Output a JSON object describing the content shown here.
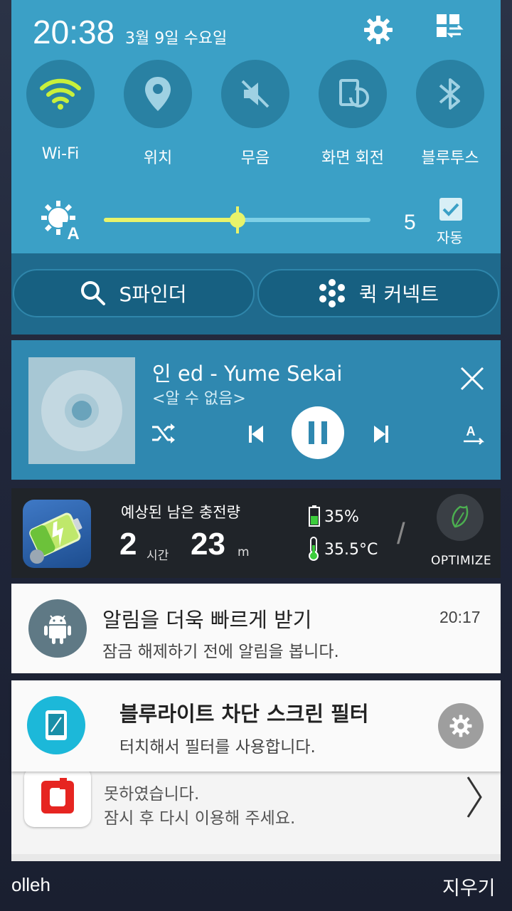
{
  "status": {
    "time": "20:38",
    "date": "3월 9일 수요일"
  },
  "quick_toggles": [
    {
      "label": "Wi-Fi",
      "icon": "wifi-icon",
      "active": true
    },
    {
      "label": "위치",
      "icon": "location-icon",
      "active": false
    },
    {
      "label": "무음",
      "icon": "mute-icon",
      "active": false
    },
    {
      "label": "화면 회전",
      "icon": "screen-rotation-icon",
      "active": false
    },
    {
      "label": "블루투스",
      "icon": "bluetooth-icon",
      "active": false
    }
  ],
  "brightness": {
    "level": 0.5,
    "value": "5",
    "auto_checked": true,
    "auto_label": "자동"
  },
  "panel_buttons": {
    "s_finder": "S파인더",
    "quick_connect": "퀵 커넥트"
  },
  "music": {
    "title": "인 ed - Yume Sekai",
    "artist": "<알 수 없음>"
  },
  "battery_widget": {
    "title": "예상된 남은 충전량",
    "hours": "2",
    "hours_unit": "시간",
    "minutes": "23",
    "minutes_unit": "m",
    "percent": "35%",
    "temperature": "35.5°C",
    "optimize_label": "OPTIMIZE"
  },
  "notifications": [
    {
      "title": "알림을 더욱 빠르게 받기",
      "text": "잠금 해제하기 전에 알림을 봅니다.",
      "time": "20:17",
      "icon": "android-icon"
    },
    {
      "title": "블루라이트 차단 스크린 필터",
      "text": "터치해서 필터를 사용합니다.",
      "icon": "phone-screen-icon"
    },
    {
      "text_line1": "못하였습니다.",
      "text_line2": "잠시 후 다시 이용해 주세요.",
      "icon": "app-logo-icon"
    }
  ],
  "footer": {
    "carrier": "olleh",
    "clear_all": "지우기"
  },
  "colors": {
    "panel_blue": "#3ba0c6",
    "panel_dark": "#1f6a8d",
    "music_blue": "#2f88b0",
    "wifi_active": "#c8f03c",
    "slider_fill": "#e8f36a"
  }
}
